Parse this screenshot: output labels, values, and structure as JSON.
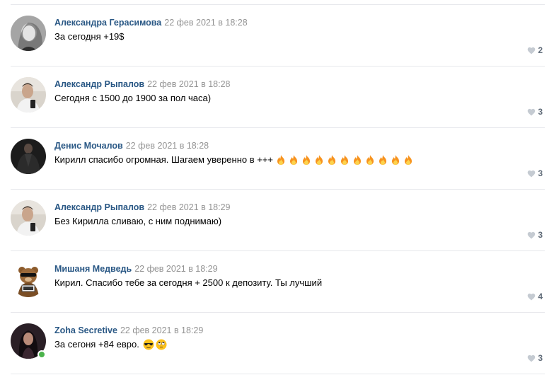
{
  "comments": [
    {
      "author": "Александра Герасимова",
      "date": "22 фев 2021 в 18:28",
      "text": "За сегодня +19$",
      "likes": "2",
      "avatar": "photo-young-woman-grayscale",
      "emojis": []
    },
    {
      "author": "Александр Рыпалов",
      "date": "22 фев 2021 в 18:28",
      "text": "Сегодня с 1500 до 1900 за пол часа)",
      "likes": "3",
      "avatar": "photo-young-man-mirror-selfie",
      "emojis": []
    },
    {
      "author": "Денис Мочалов",
      "date": "22 фев 2021 в 18:28",
      "text": "Кирилл спасибо огромная. Шагаем уверенно в +++",
      "likes": "3",
      "avatar": "photo-man-dark-jacket",
      "emojis": [
        "fire-emoji",
        "fire-emoji",
        "fire-emoji",
        "fire-emoji",
        "fire-emoji",
        "fire-emoji",
        "fire-emoji",
        "fire-emoji",
        "fire-emoji",
        "fire-emoji",
        "fire-emoji"
      ]
    },
    {
      "author": "Александр Рыпалов",
      "date": "22 фев 2021 в 18:29",
      "text": "Без Кирилла сливаю, с ним поднимаю)",
      "likes": "3",
      "avatar": "photo-young-man-mirror-selfie",
      "emojis": []
    },
    {
      "author": "Мишаня Медведь",
      "date": "22 фев 2021 в 18:29",
      "text": "Кирил. Спасибо тебе за сегодня + 2500 к депозиту. Ты лучший",
      "likes": "4",
      "avatar": "cartoon-bear-sunglasses",
      "emojis": []
    },
    {
      "author": "Zoha Secretive",
      "date": "22 фев 2021 в 18:29",
      "text": "За сегоня +84 евро.",
      "likes": "3",
      "avatar": "photo-woman-dark-hair",
      "online": true,
      "emojis": [
        "sunglasses-face-emoji",
        "rolling-eyes-face-emoji"
      ]
    }
  ],
  "colors": {
    "author": "#2a5885",
    "date": "#939393",
    "divider": "#e7e8ec",
    "like": "#c5cbd2",
    "online": "#4bb34b"
  }
}
